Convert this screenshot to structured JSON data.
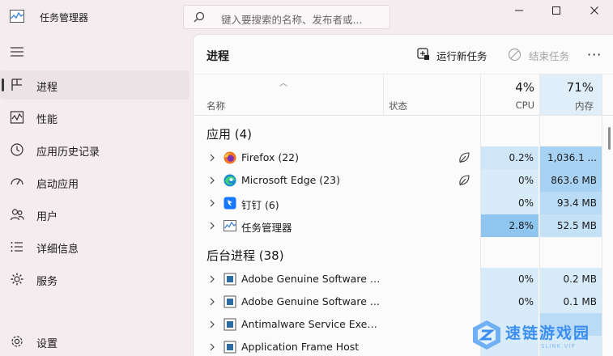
{
  "window": {
    "title": "任务管理器",
    "search_placeholder": "键入要搜索的名称、发布者或..."
  },
  "sidebar": {
    "items": [
      {
        "label": "进程",
        "icon": "processes-icon",
        "active": true
      },
      {
        "label": "性能",
        "icon": "performance-icon",
        "active": false
      },
      {
        "label": "应用历史记录",
        "icon": "history-icon",
        "active": false
      },
      {
        "label": "启动应用",
        "icon": "startup-icon",
        "active": false
      },
      {
        "label": "用户",
        "icon": "users-icon",
        "active": false
      },
      {
        "label": "详细信息",
        "icon": "details-icon",
        "active": false
      },
      {
        "label": "服务",
        "icon": "services-icon",
        "active": false
      }
    ],
    "settings_label": "设置"
  },
  "main": {
    "title": "进程",
    "run_new_task": "运行新任务",
    "end_task": "结束任务",
    "more": "···",
    "columns": {
      "name": "名称",
      "status": "状态",
      "cpu_total": "4%",
      "cpu": "CPU",
      "mem_total": "71%",
      "mem": "内存"
    },
    "apps_section": "应用 (4)",
    "apps": [
      {
        "name": "Firefox (22)",
        "icon": "firefox-icon",
        "efficiency": true,
        "cpu": "0.2%",
        "mem": "1,036.1 ..."
      },
      {
        "name": "Microsoft Edge (23)",
        "icon": "edge-icon",
        "efficiency": true,
        "cpu": "0%",
        "mem": "863.6 MB"
      },
      {
        "name": "钉钉 (6)",
        "icon": "dingtalk-icon",
        "efficiency": false,
        "cpu": "0%",
        "mem": "93.4 MB"
      },
      {
        "name": "任务管理器",
        "icon": "task-manager-icon",
        "efficiency": false,
        "cpu": "2.8%",
        "mem": "52.5 MB"
      }
    ],
    "bg_section": "后台进程 (38)",
    "background": [
      {
        "name": "Adobe Genuine Software In...",
        "icon": "service-box-icon",
        "cpu": "0%",
        "mem": "0.2 MB"
      },
      {
        "name": "Adobe Genuine Software ...",
        "icon": "service-box-icon",
        "cpu": "0%",
        "mem": "0.1 MB"
      },
      {
        "name": "Antimalware Service Execut...",
        "icon": "service-box-icon",
        "cpu": "",
        "mem": ""
      },
      {
        "name": "Application Frame Host",
        "icon": "service-box-icon",
        "cpu": "",
        "mem": ""
      }
    ]
  },
  "watermark": {
    "text": "速链游戏园",
    "sub": "SLINK.VIP"
  }
}
